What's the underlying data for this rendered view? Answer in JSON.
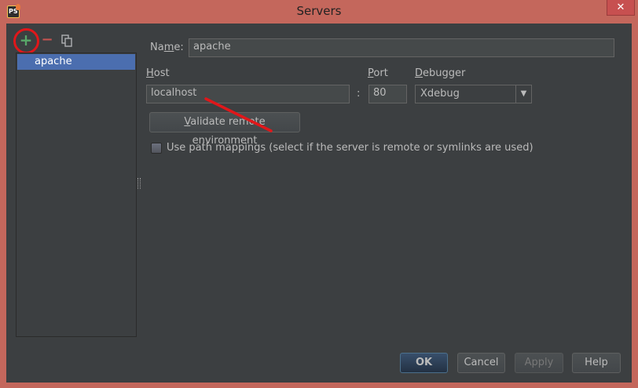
{
  "window": {
    "title": "Servers",
    "close_label": "✕",
    "app_icon_text": "PS"
  },
  "toolbar": {
    "add_icon": "plus-icon",
    "remove_icon": "minus-icon",
    "copy_icon": "copy-icon",
    "add_glyph": "+",
    "remove_glyph": "−"
  },
  "server_list": {
    "items": [
      {
        "label": "apache",
        "selected": true
      }
    ]
  },
  "form": {
    "name_label_prefix": "Na",
    "name_label_mnemonic": "m",
    "name_label_suffix": "e:",
    "name_value": "apache",
    "host_label_mnemonic": "H",
    "host_label_rest": "ost",
    "host_value": "localhost",
    "port_separator": ":",
    "port_label_mnemonic": "P",
    "port_label_rest": "ort",
    "port_value": "80",
    "debugger_label_mnemonic": "D",
    "debugger_label_rest": "ebugger",
    "debugger_value": "Xdebug",
    "validate_button_mnemonic": "V",
    "validate_button_rest": "alidate remote environment",
    "path_mappings_label": "Use path mappings (select if the server is remote or symlinks are used)",
    "path_mappings_checked": false
  },
  "footer": {
    "ok_label": "OK",
    "cancel_label": "Cancel",
    "apply_label": "Apply",
    "help_label": "Help"
  },
  "colors": {
    "window_frame": "#c4675c",
    "panel_bg": "#3c3f41",
    "selection": "#4b6eaf",
    "annotation_red": "#e0171a",
    "add_green": "#59a869",
    "remove_red": "#c75450"
  }
}
